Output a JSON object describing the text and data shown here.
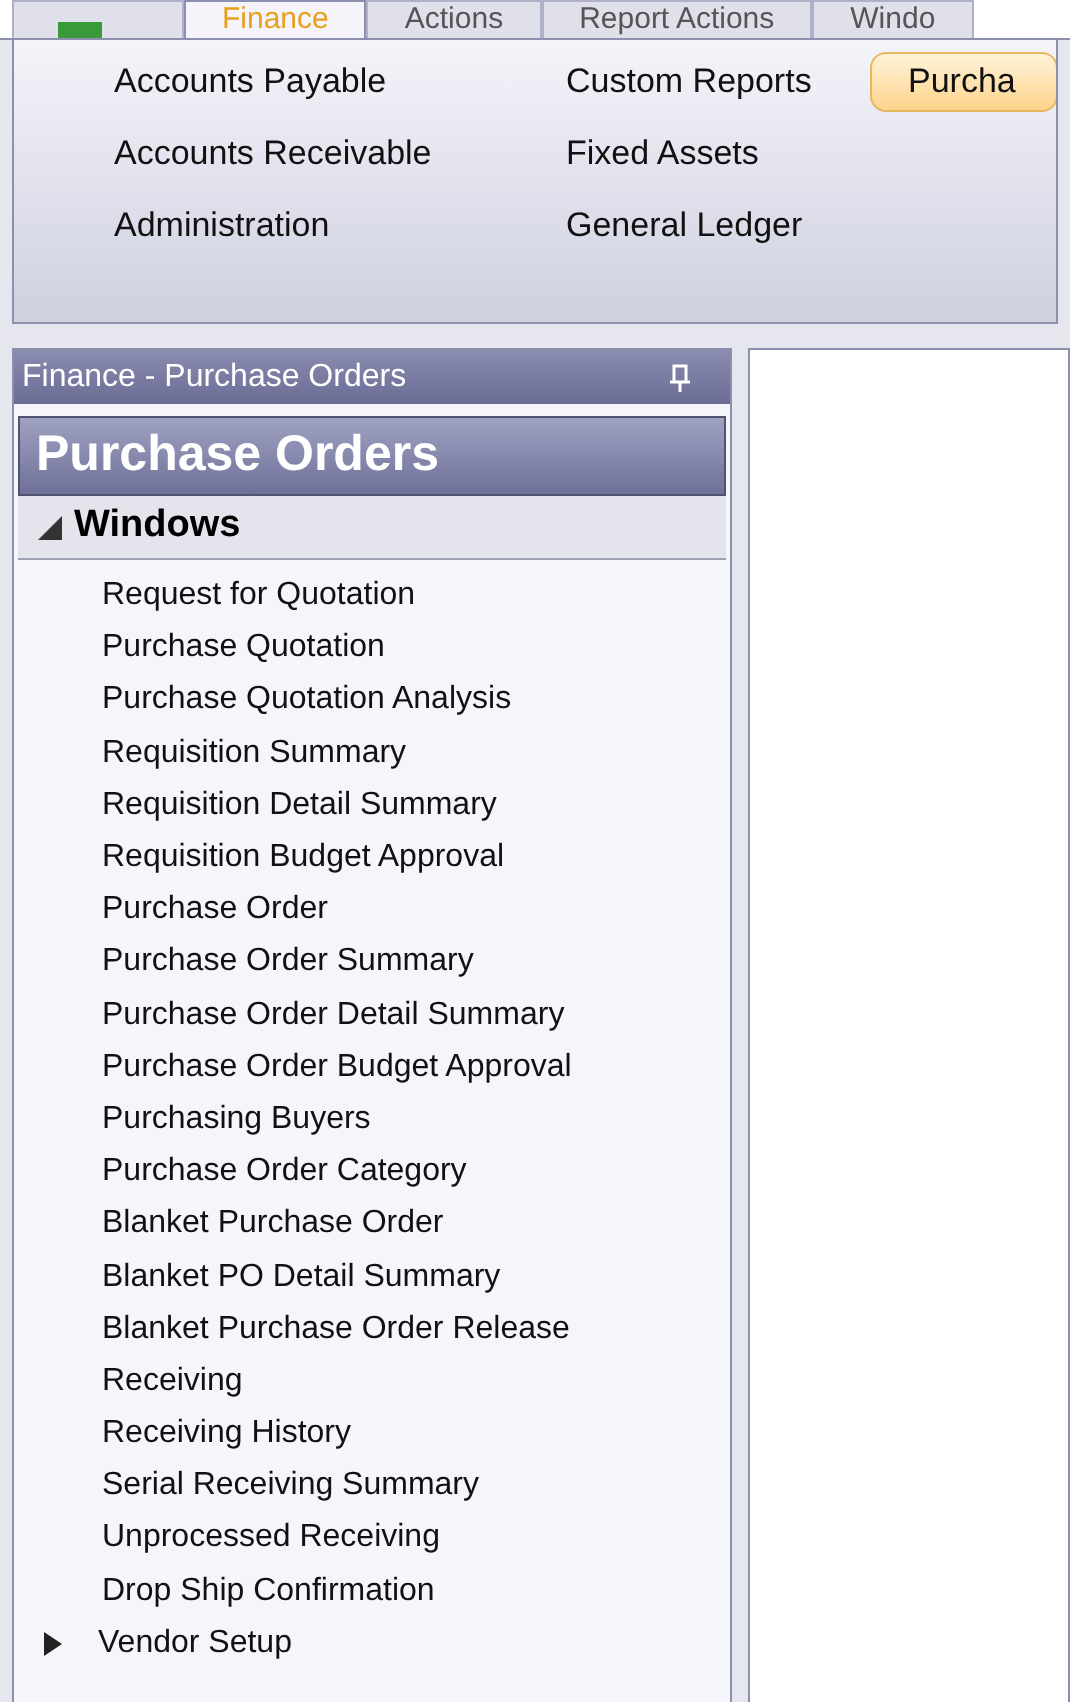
{
  "ribbon_tabs": [
    {
      "kind": "app",
      "selected": false
    },
    {
      "label": "Finance",
      "selected": true
    },
    {
      "label": "Actions",
      "selected": false
    },
    {
      "label": "Report Actions",
      "selected": false
    },
    {
      "label": "Windo",
      "selected": false
    }
  ],
  "ribbon_columns": [
    {
      "items": [
        {
          "label": "Accounts Payable",
          "selected": false
        },
        {
          "label": "Accounts Receivable",
          "selected": false
        },
        {
          "label": "Administration",
          "selected": false
        }
      ]
    },
    {
      "items": [
        {
          "label": "Custom Reports",
          "selected": false
        },
        {
          "label": "Fixed Assets",
          "selected": false
        },
        {
          "label": "General Ledger",
          "selected": false
        }
      ]
    },
    {
      "items": [
        {
          "label": "Purcha",
          "selected": true
        }
      ]
    }
  ],
  "panel": {
    "title": "Finance - Purchase Orders",
    "heading": "Purchase Orders",
    "groups": [
      {
        "label": "Windows",
        "expanded": true,
        "items": [
          {
            "label": "Request for Quotation"
          },
          {
            "label": "Purchase Quotation"
          },
          {
            "label": "Purchase Quotation Analysis"
          },
          {
            "label": "Requisition Summary"
          },
          {
            "label": "Requisition Detail Summary"
          },
          {
            "label": "Requisition Budget Approval"
          },
          {
            "label": "Purchase Order"
          },
          {
            "label": "Purchase Order Summary"
          },
          {
            "label": "Purchase Order Detail Summary"
          },
          {
            "label": "Purchase Order Budget Approval"
          },
          {
            "label": "Purchasing Buyers"
          },
          {
            "label": "Purchase Order Category"
          },
          {
            "label": "Blanket Purchase Order"
          },
          {
            "label": "Blanket PO Detail Summary"
          },
          {
            "label": "Blanket Purchase Order Release"
          },
          {
            "label": "Receiving"
          },
          {
            "label": "Receiving History"
          },
          {
            "label": "Serial Receiving Summary"
          },
          {
            "label": "Unprocessed Receiving"
          },
          {
            "label": "Drop Ship Confirmation"
          },
          {
            "label": "Vendor Setup",
            "expanded": false
          }
        ]
      }
    ]
  }
}
